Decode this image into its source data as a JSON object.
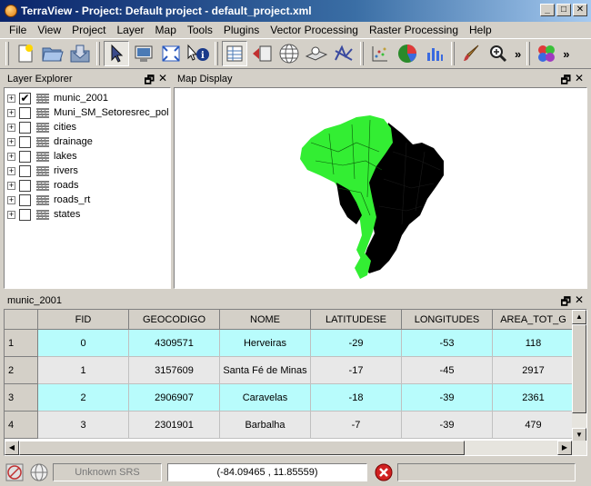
{
  "window": {
    "title": "TerraView - Project: Default project - default_project.xml",
    "minimize": "_",
    "maximize": "□",
    "close": "✕"
  },
  "menu": [
    "File",
    "View",
    "Project",
    "Layer",
    "Map",
    "Tools",
    "Plugins",
    "Vector Processing",
    "Raster Processing",
    "Help"
  ],
  "toolbar": {
    "icons": [
      "new-project-icon",
      "open-folder-icon",
      "save-icon",
      "pointer-icon",
      "pan-icon",
      "zoom-extent-icon",
      "info-icon",
      "layer-table-icon",
      "remove-layer-icon",
      "globe-icon",
      "point-layer-icon",
      "vector-graph-icon",
      "scatter-chart-icon",
      "pie-chart-icon",
      "bar-chart-icon",
      "brush-icon",
      "zoom-in-icon",
      "color-style-icon"
    ],
    "overflow": "»"
  },
  "layer_explorer": {
    "title": "Layer Explorer",
    "float": "🗗",
    "close": "✕",
    "layers": [
      {
        "name": "munic_2001",
        "checked": true,
        "check_mark": "✔"
      },
      {
        "name": "Muni_SM_Setoresrec_pol",
        "checked": false
      },
      {
        "name": "cities",
        "checked": false
      },
      {
        "name": "drainage",
        "checked": false
      },
      {
        "name": "lakes",
        "checked": false
      },
      {
        "name": "rivers",
        "checked": false
      },
      {
        "name": "roads",
        "checked": false
      },
      {
        "name": "roads_rt",
        "checked": false
      },
      {
        "name": "states",
        "checked": false
      }
    ],
    "expander": "+"
  },
  "map_display": {
    "title": "Map Display",
    "float": "🗗",
    "close": "✕",
    "colors": {
      "green": "#33ee33",
      "black": "#000000"
    }
  },
  "table": {
    "title": "munic_2001",
    "float": "🗗",
    "close": "✕",
    "columns": [
      "FID",
      "GEOCODIGO",
      "NOME",
      "LATITUDESE",
      "LONGITUDES",
      "AREA_TOT_G"
    ],
    "rows": [
      {
        "num": "1",
        "cells": [
          "0",
          "4309571",
          "Herveiras",
          "-29",
          "-53",
          "118"
        ]
      },
      {
        "num": "2",
        "cells": [
          "1",
          "3157609",
          "Santa Fé de Minas",
          "-17",
          "-45",
          "2917"
        ]
      },
      {
        "num": "3",
        "cells": [
          "2",
          "2906907",
          "Caravelas",
          "-18",
          "-39",
          "2361"
        ]
      },
      {
        "num": "4",
        "cells": [
          "3",
          "2301901",
          "Barbalha",
          "-7",
          "-39",
          "479"
        ]
      }
    ],
    "scroll_up": "▲",
    "scroll_down": "▼",
    "scroll_left": "◀",
    "scroll_right": "▶"
  },
  "status": {
    "srs": "Unknown SRS",
    "coordinates": "(-84.09465 , 11.85559)"
  }
}
